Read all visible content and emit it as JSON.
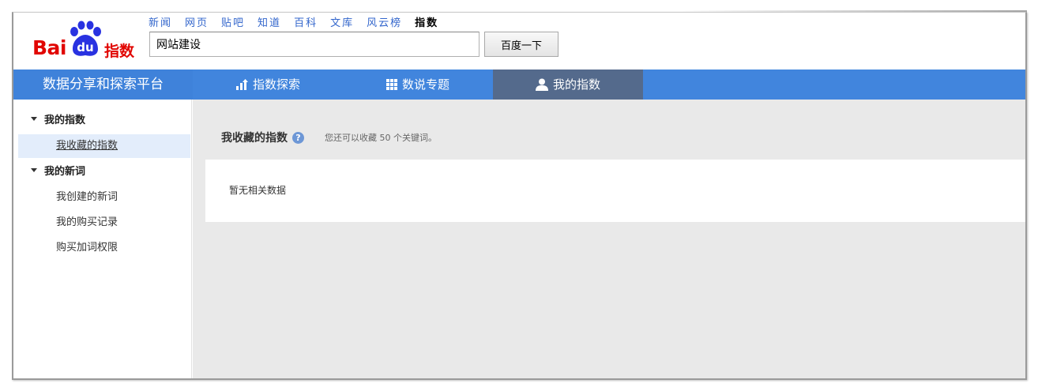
{
  "logo": {
    "brand_text": "Bai",
    "paw_text": "du",
    "product_text": "指数"
  },
  "topnav": {
    "items": [
      "新闻",
      "网页",
      "贴吧",
      "知道",
      "百科",
      "文库",
      "风云榜",
      "指数"
    ],
    "active": "指数"
  },
  "search": {
    "value": "网站建设",
    "button_label": "百度一下"
  },
  "mainbar": {
    "platform_title": "数据分享和探索平台",
    "tabs": [
      {
        "label": "指数探索",
        "icon": "bar-chart-icon"
      },
      {
        "label": "数说专题",
        "icon": "grid-icon"
      },
      {
        "label": "我的指数",
        "icon": "user-icon",
        "active": true
      }
    ]
  },
  "sidebar": {
    "groups": [
      {
        "label": "我的指数",
        "items": [
          {
            "label": "我收藏的指数",
            "active": true
          }
        ]
      },
      {
        "label": "我的新词",
        "items": [
          {
            "label": "我创建的新词"
          },
          {
            "label": "我的购买记录"
          },
          {
            "label": "购买加词权限"
          }
        ]
      }
    ]
  },
  "main": {
    "title": "我收藏的指数",
    "help_icon": "?",
    "note": "您还可以收藏 50 个关键词。",
    "empty_text": "暂无相关数据"
  },
  "colors": {
    "brand_red": "#e10602",
    "nav_blue": "#4185dd",
    "active_tab": "#546a8c",
    "link_blue": "#3366cc"
  }
}
